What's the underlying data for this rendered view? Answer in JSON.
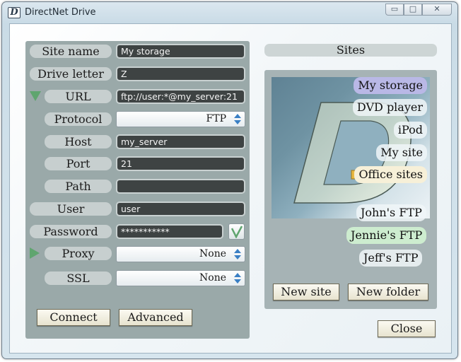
{
  "window": {
    "title": "DirectNet Drive",
    "icon_letter": "D",
    "minimize_glyph": "▭",
    "maximize_glyph": "□",
    "close_glyph": "✕"
  },
  "form": {
    "site_name": {
      "label": "Site name",
      "value": "My storage"
    },
    "drive_letter": {
      "label": "Drive letter",
      "value": "Z"
    },
    "url": {
      "label": "URL",
      "value": "ftp://user:*@my_server:21"
    },
    "protocol": {
      "label": "Protocol",
      "value": "FTP"
    },
    "host": {
      "label": "Host",
      "value": "my_server"
    },
    "port": {
      "label": "Port",
      "value": "21"
    },
    "path": {
      "label": "Path",
      "value": ""
    },
    "user": {
      "label": "User",
      "value": "user"
    },
    "password": {
      "label": "Password",
      "value": "***********"
    },
    "proxy": {
      "label": "Proxy",
      "value": "None"
    },
    "ssl": {
      "label": "SSL",
      "value": "None"
    }
  },
  "buttons": {
    "connect": "Connect",
    "advanced": "Advanced",
    "new_site": "New site",
    "new_folder": "New folder",
    "close": "Close"
  },
  "sites": {
    "header": "Sites",
    "items": [
      {
        "label": "My storage",
        "selected": true
      },
      {
        "label": "DVD player"
      },
      {
        "label": "iPod"
      },
      {
        "label": "My site"
      },
      {
        "label": "Office sites",
        "icon": "folder-icon"
      },
      {
        "label": "John's FTP"
      },
      {
        "label": "Jennie's FTP"
      },
      {
        "label": "Jeff's FTP"
      }
    ]
  },
  "colors": {
    "accent_green": "#5fa56f",
    "spinner_blue": "#3a7fc4",
    "selected_site": "#b9b8e6"
  }
}
